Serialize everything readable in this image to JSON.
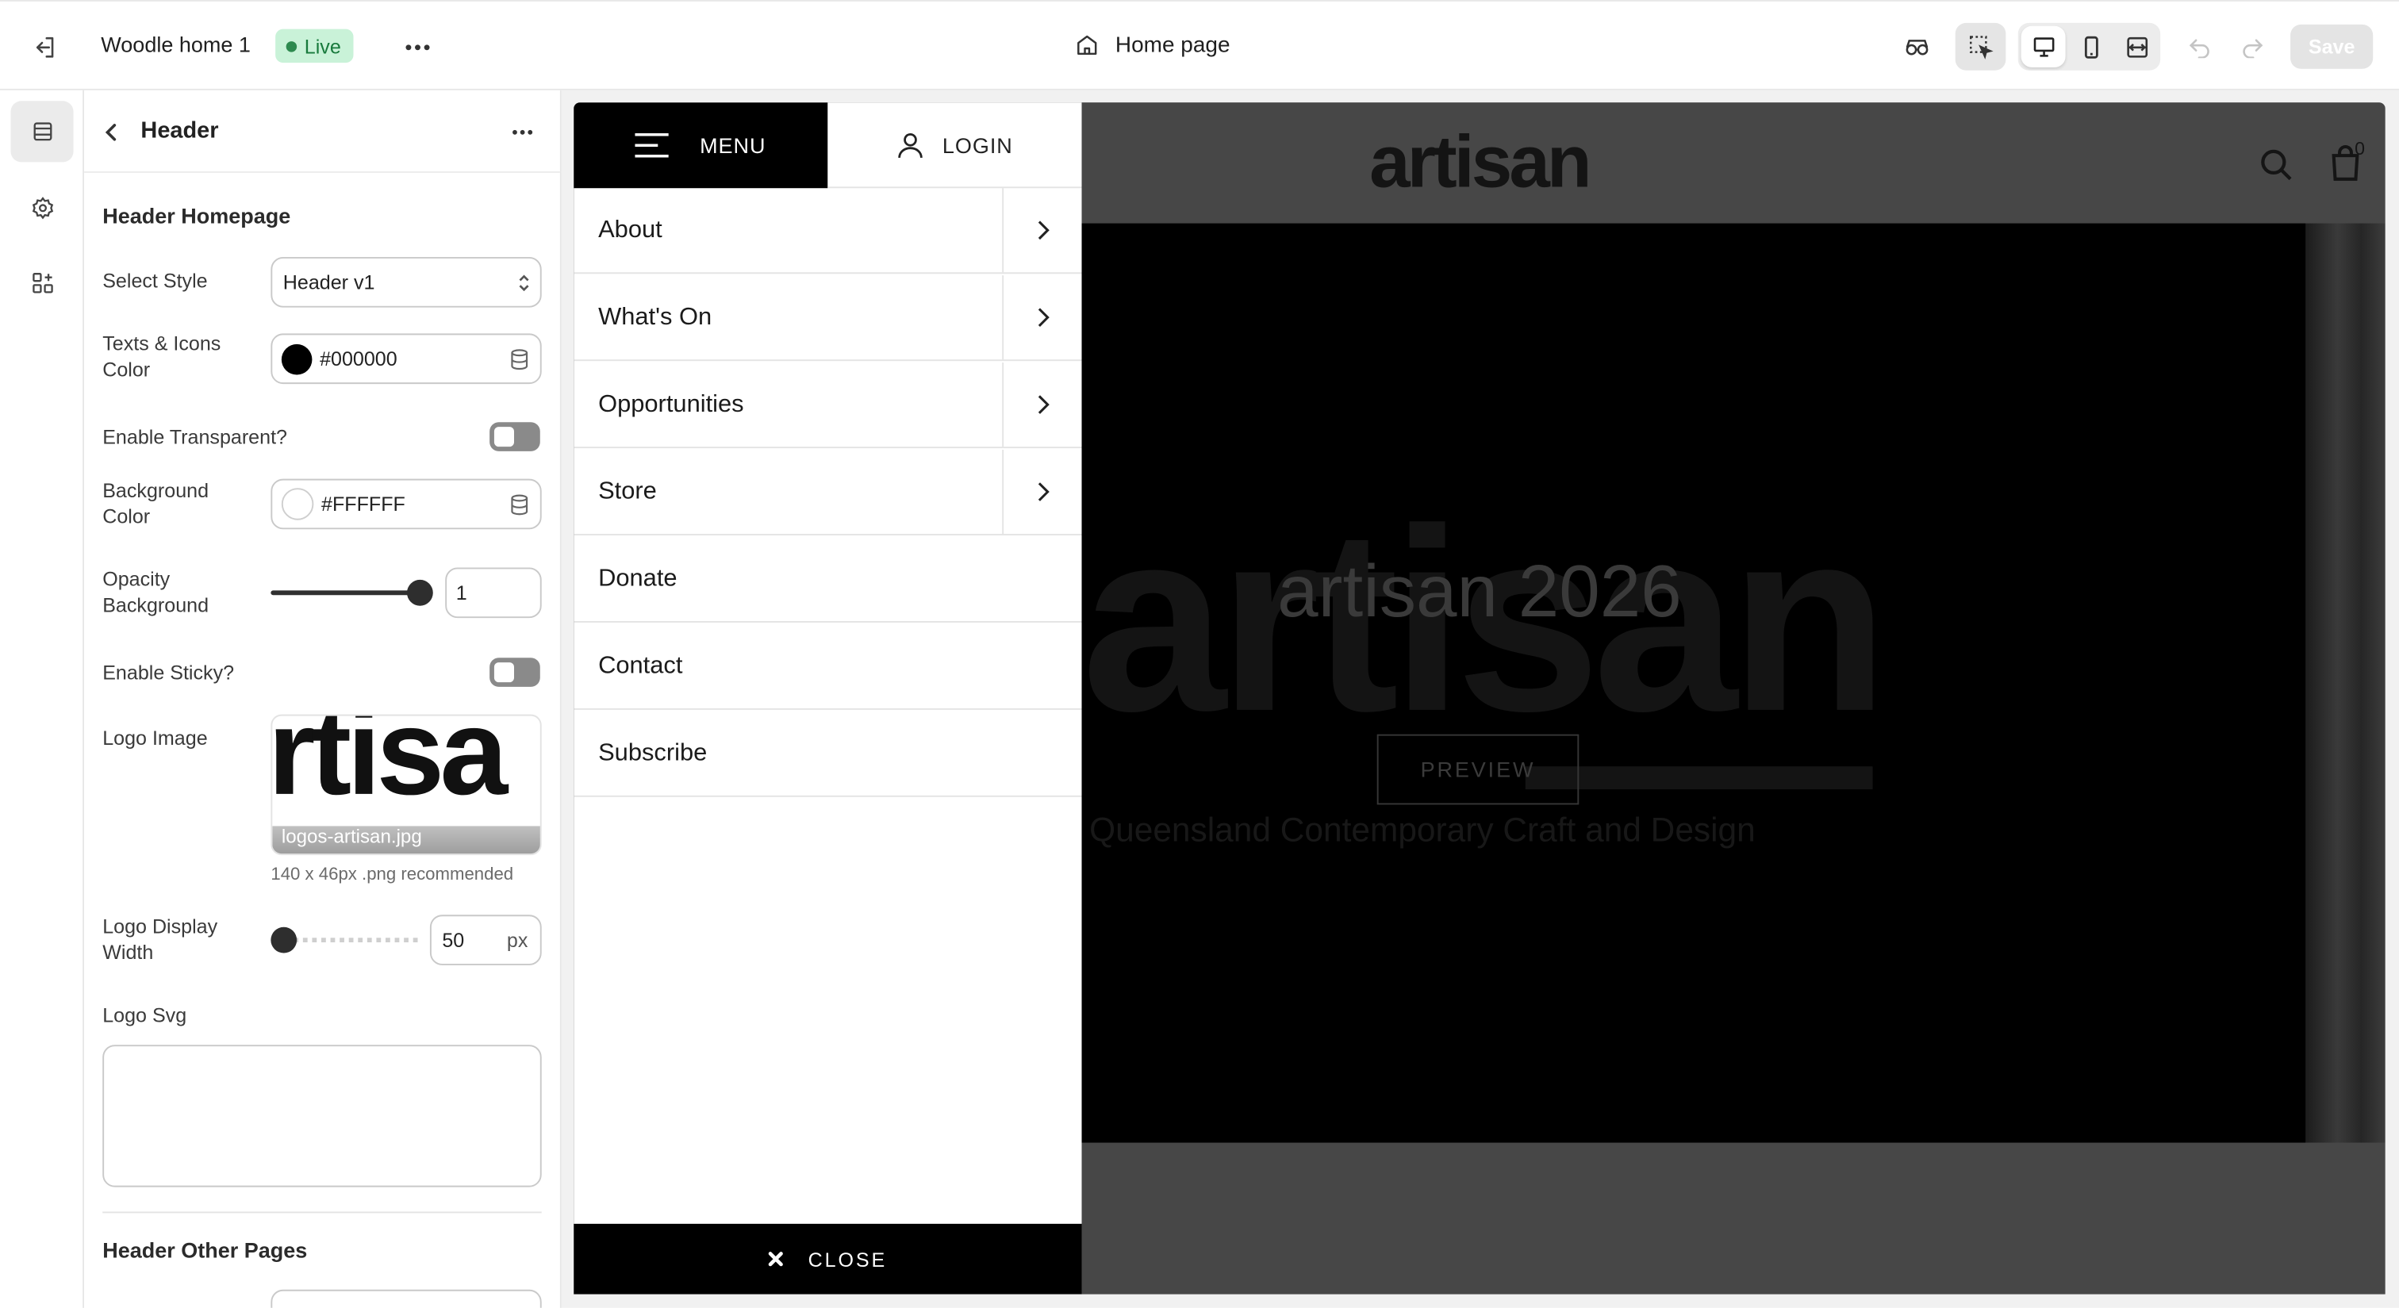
{
  "topbar": {
    "site_name": "Woodle home 1",
    "status_badge": "Live",
    "page_name": "Home page",
    "save_label": "Save",
    "icons": [
      "exit-icon",
      "more-icon",
      "home-icon",
      "preview-glasses-icon",
      "select-element-icon",
      "desktop-icon",
      "mobile-icon",
      "fullwidth-icon",
      "undo-icon",
      "redo-icon"
    ]
  },
  "rail": {
    "items": [
      {
        "icon": "sections-icon",
        "active": true
      },
      {
        "icon": "gear-icon",
        "active": false
      },
      {
        "icon": "apps-icon",
        "active": false
      }
    ]
  },
  "panel": {
    "title": "Header",
    "section1": "Header Homepage",
    "select_style_label": "Select Style",
    "select_style_value": "Header v1",
    "text_color_label": "Texts & Icons Color",
    "text_color_value": "#000000",
    "enable_transparent_label": "Enable Transparent?",
    "bg_color_label": "Background Color",
    "bg_color_value": "#FFFFFF",
    "opacity_label": "Opacity Background",
    "opacity_value": "1",
    "opacity_level": 1,
    "enable_sticky_label": "Enable Sticky?",
    "logo_image_label": "Logo Image",
    "logo_filename": "logos-artisan.jpg",
    "logo_thumb_text": "rtisa",
    "logo_hint": "140 x 46px .png recommended",
    "logo_width_label": "Logo Display Width",
    "logo_width_value": "50",
    "logo_width_unit": "px",
    "logo_svg_label": "Logo Svg",
    "section2": "Header Other Pages"
  },
  "preview": {
    "menu_tab": "MENU",
    "login_tab": "LOGIN",
    "menu_items": [
      {
        "label": "About",
        "has_sub": true
      },
      {
        "label": "What's On",
        "has_sub": true
      },
      {
        "label": "Opportunities",
        "has_sub": true
      },
      {
        "label": "Store",
        "has_sub": true
      },
      {
        "label": "Donate",
        "has_sub": false
      },
      {
        "label": "Contact",
        "has_sub": false
      },
      {
        "label": "Subscribe",
        "has_sub": false
      }
    ],
    "close_label": "CLOSE",
    "site_logo": "artisan",
    "cart_count": "0",
    "hero_big_word": "artisan",
    "hero_title": "artisan 2026",
    "hero_subtitle": "Queensland Contemporary Craft and Design",
    "hero_button": "PREVIEW"
  }
}
